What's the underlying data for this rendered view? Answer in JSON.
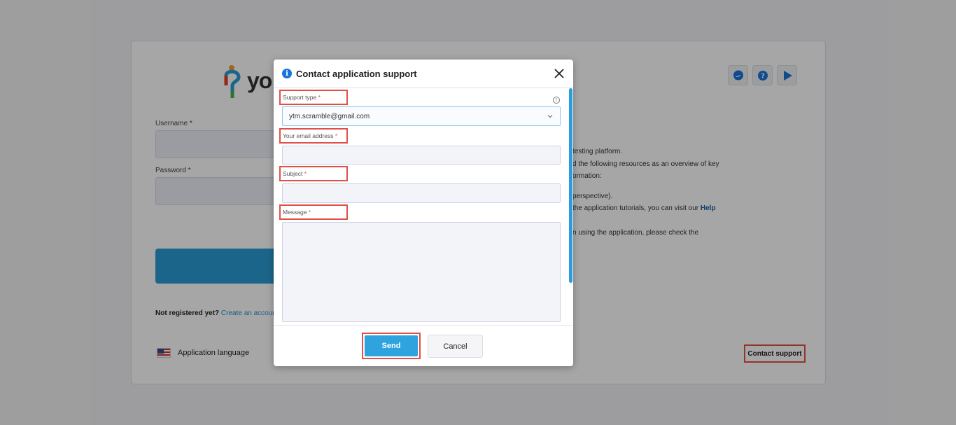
{
  "background": {
    "logo_text": "yo",
    "username_label": "Username *",
    "password_label": "Password *",
    "not_registered": "Not registered yet?",
    "create_account": "Create an accoun",
    "application_language": "Application language",
    "contact_support": "Contact support",
    "right_lines": [
      "testing platform.",
      "d the following resources as an overview of key",
      "ormation:",
      "perspective).",
      "the application tutorials, you can visit our",
      "n using the application, please check the"
    ],
    "help_link": "Help",
    "top_icons": [
      "chat-icon",
      "help-icon",
      "play-icon"
    ]
  },
  "modal": {
    "title": "Contact application support",
    "support_type_label": "Support type",
    "support_type_value": "ytm.scramble@gmail.com",
    "email_label": "Your email address",
    "email_value": "",
    "subject_label": "Subject",
    "subject_value": "",
    "message_label": "Message",
    "message_value": "",
    "required_mark": "*",
    "send_label": "Send",
    "cancel_label": "Cancel"
  },
  "colors": {
    "accent": "#2ea3de",
    "highlight": "#e05048",
    "info": "#1a73d9"
  }
}
